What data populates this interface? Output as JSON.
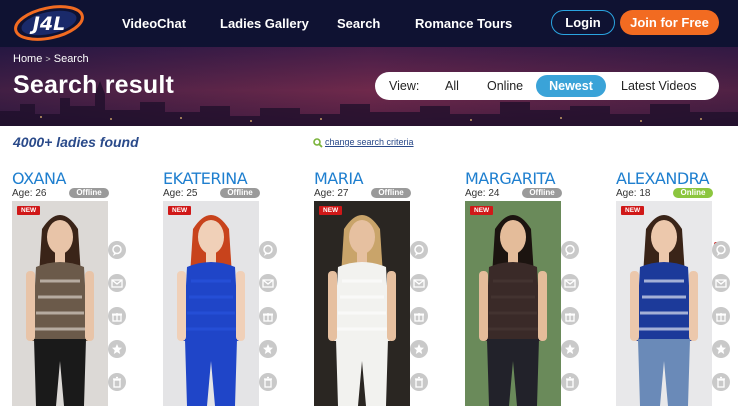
{
  "nav": {
    "logo_text": "J4L",
    "links": [
      "VideoChat",
      "Ladies Gallery",
      "Search",
      "Romance Tours"
    ],
    "login": "Login",
    "join": "Join for Free"
  },
  "banner": {
    "breadcrumb_home": "Home",
    "breadcrumb_sep": ">",
    "breadcrumb_current": "Search",
    "title": "Search result",
    "view_label": "View:",
    "view_options": [
      "All",
      "Online",
      "Newest",
      "Latest Videos"
    ],
    "view_active": "Newest"
  },
  "results": {
    "found_text": "4000+ ladies found",
    "criteria_link": "change search criteria"
  },
  "badge_new": "NEW",
  "colors": {
    "offline": "#9a9a9a",
    "online": "#8cc63f",
    "accent": "#3aa3d8",
    "join": "#f26b21",
    "nav_bg": "#0f1232"
  },
  "ladies": [
    {
      "name": "OXANA",
      "age": "Age: 26",
      "status": "Offline",
      "online": false
    },
    {
      "name": "EKATERINA",
      "age": "Age: 25",
      "status": "Offline",
      "online": false
    },
    {
      "name": "MARIA",
      "age": "Age: 27",
      "status": "Offline",
      "online": false
    },
    {
      "name": "MARGARITA",
      "age": "Age: 24",
      "status": "Offline",
      "online": false
    },
    {
      "name": "ALEXANDRA",
      "age": "Age: 18",
      "status": "Online",
      "online": true
    }
  ],
  "action_icons": [
    "chat-icon",
    "mail-icon",
    "gift-icon",
    "star-icon",
    "trash-icon"
  ]
}
